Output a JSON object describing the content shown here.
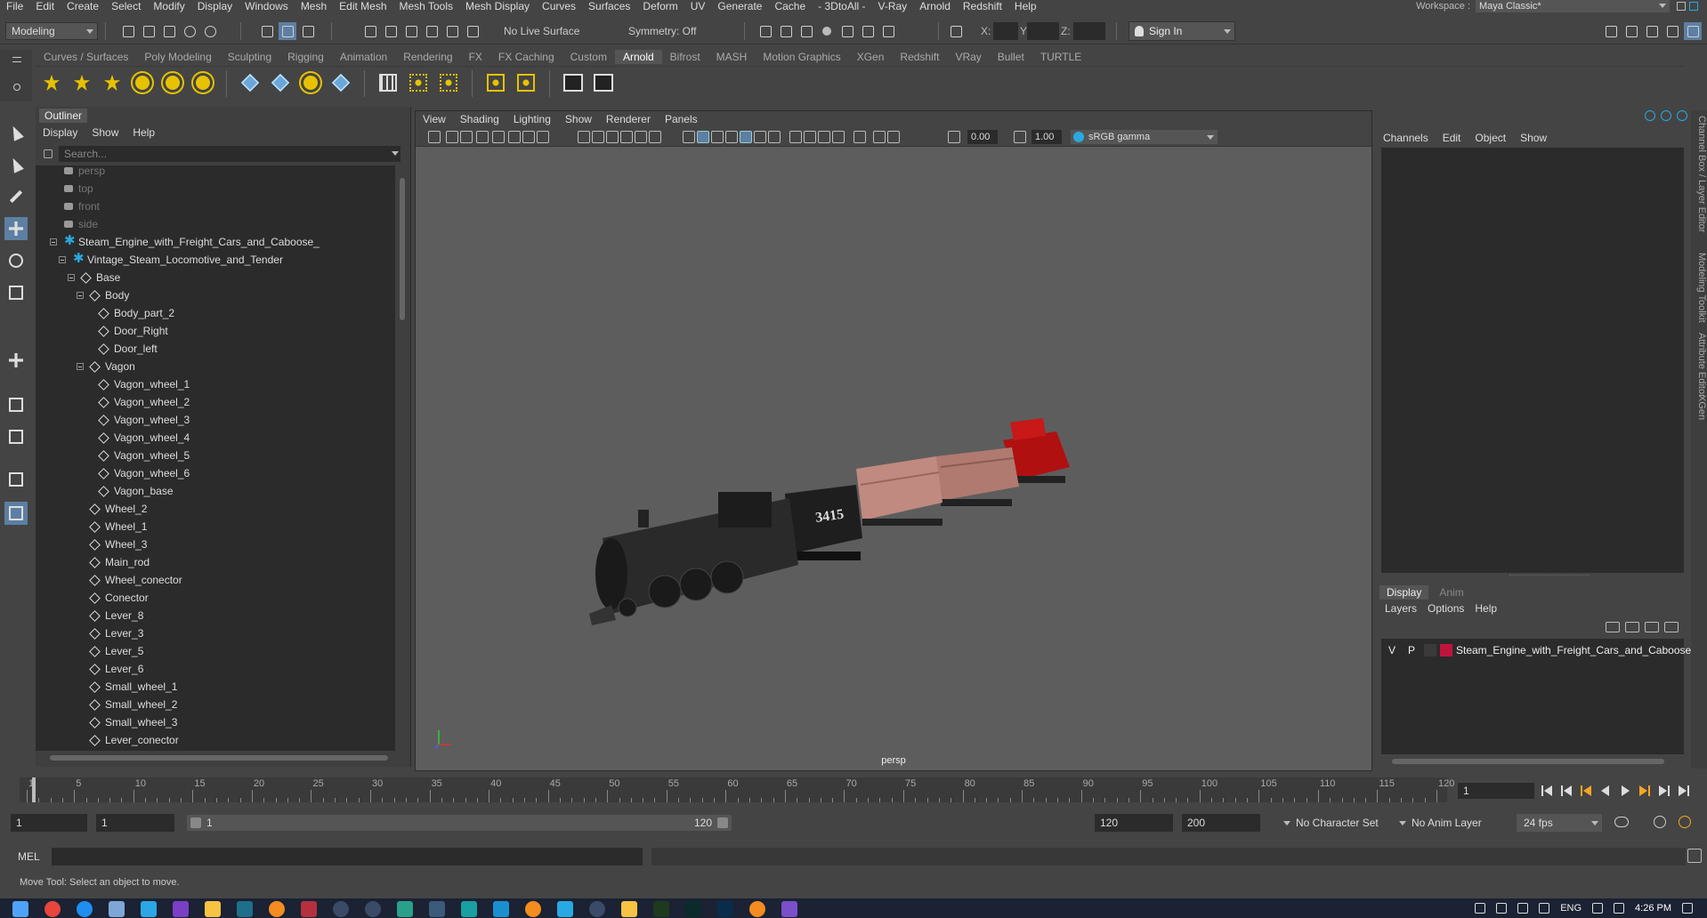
{
  "menubar": {
    "items": [
      "File",
      "Edit",
      "Create",
      "Select",
      "Modify",
      "Display",
      "Windows",
      "Mesh",
      "Edit Mesh",
      "Mesh Tools",
      "Mesh Display",
      "Curves",
      "Surfaces",
      "Deform",
      "UV",
      "Generate",
      "Cache",
      "- 3DtoAll -",
      "V-Ray",
      "Arnold",
      "Redshift",
      "Help"
    ],
    "workspace_label": "Workspace :",
    "workspace_value": "Maya Classic*"
  },
  "statusline": {
    "mode": "Modeling",
    "live_surface": "No Live Surface",
    "symmetry": "Symmetry: Off",
    "x_label": "X:",
    "y_label": "Y:",
    "z_label": "Z:",
    "sign_in": "Sign In"
  },
  "shelf": {
    "tabs": [
      "Curves / Surfaces",
      "Poly Modeling",
      "Sculpting",
      "Rigging",
      "Animation",
      "Rendering",
      "FX",
      "FX Caching",
      "Custom",
      "Arnold",
      "Bifrost",
      "MASH",
      "Motion Graphics",
      "XGen",
      "Redshift",
      "VRay",
      "Bullet",
      "TURTLE"
    ],
    "active_tab": "Arnold"
  },
  "outliner": {
    "title": "Outliner",
    "menu": [
      "Display",
      "Show",
      "Help"
    ],
    "search_placeholder": "Search...",
    "items": [
      {
        "label": "persp",
        "type": "camera",
        "dim": true
      },
      {
        "label": "top",
        "type": "camera",
        "dim": true
      },
      {
        "label": "front",
        "type": "camera",
        "dim": true
      },
      {
        "label": "side",
        "type": "camera",
        "dim": true
      },
      {
        "label": "Steam_Engine_with_Freight_Cars_and_Caboose_",
        "type": "asset"
      },
      {
        "label": "Vintage_Steam_Locomotive_and_Tender",
        "type": "asset"
      },
      {
        "label": "Base",
        "type": "mesh"
      },
      {
        "label": "Body",
        "type": "mesh"
      },
      {
        "label": "Body_part_2",
        "type": "mesh"
      },
      {
        "label": "Door_Right",
        "type": "mesh"
      },
      {
        "label": "Door_left",
        "type": "mesh"
      },
      {
        "label": "Vagon",
        "type": "mesh"
      },
      {
        "label": "Vagon_wheel_1",
        "type": "mesh"
      },
      {
        "label": "Vagon_wheel_2",
        "type": "mesh"
      },
      {
        "label": "Vagon_wheel_3",
        "type": "mesh"
      },
      {
        "label": "Vagon_wheel_4",
        "type": "mesh"
      },
      {
        "label": "Vagon_wheel_5",
        "type": "mesh"
      },
      {
        "label": "Vagon_wheel_6",
        "type": "mesh"
      },
      {
        "label": "Vagon_base",
        "type": "mesh"
      },
      {
        "label": "Wheel_2",
        "type": "mesh"
      },
      {
        "label": "Wheel_1",
        "type": "mesh"
      },
      {
        "label": "Wheel_3",
        "type": "mesh"
      },
      {
        "label": "Main_rod",
        "type": "mesh"
      },
      {
        "label": "Wheel_conector",
        "type": "mesh"
      },
      {
        "label": "Conector",
        "type": "mesh"
      },
      {
        "label": "Lever_8",
        "type": "mesh"
      },
      {
        "label": "Lever_3",
        "type": "mesh"
      },
      {
        "label": "Lever_5",
        "type": "mesh"
      },
      {
        "label": "Lever_6",
        "type": "mesh"
      },
      {
        "label": "Small_wheel_1",
        "type": "mesh"
      },
      {
        "label": "Small_wheel_2",
        "type": "mesh"
      },
      {
        "label": "Small_wheel_3",
        "type": "mesh"
      },
      {
        "label": "Lever_conector",
        "type": "mesh"
      }
    ]
  },
  "viewport": {
    "menu": [
      "View",
      "Shading",
      "Lighting",
      "Show",
      "Renderer",
      "Panels"
    ],
    "exposure": "0.00",
    "gamma": "1.00",
    "color_space": "sRGB gamma",
    "camera_label": "persp",
    "engine_number": "3415"
  },
  "channelbox": {
    "menu": [
      "Channels",
      "Edit",
      "Object",
      "Show"
    ],
    "side_tabs": [
      "Channel Box / Layer Editor",
      "Modeling Toolkit",
      "Attribute Editor",
      "XGen"
    ]
  },
  "layer_editor": {
    "tabs": [
      "Display",
      "Anim"
    ],
    "menu": [
      "Layers",
      "Options",
      "Help"
    ],
    "layer": {
      "v": "V",
      "p": "P",
      "name": "Steam_Engine_with_Freight_Cars_and_Caboose",
      "color": "#c0143c"
    }
  },
  "timeslider": {
    "ticks": [
      "1",
      "5",
      "10",
      "15",
      "20",
      "25",
      "30",
      "35",
      "40",
      "45",
      "50",
      "55",
      "60",
      "65",
      "70",
      "75",
      "80",
      "85",
      "90",
      "95",
      "100",
      "105",
      "110",
      "115",
      "120"
    ],
    "current_frame": "1"
  },
  "range": {
    "start": "1",
    "playback_start": "1",
    "range_start": "1",
    "range_end": "120",
    "playback_end": "120",
    "end": "200",
    "character_set": "No Character Set",
    "anim_layer": "No Anim Layer",
    "fps": "24 fps"
  },
  "cmdline": {
    "mel_label": "MEL"
  },
  "helpline": {
    "text": "Move Tool: Select an object to move."
  },
  "taskbar": {
    "lang": "ENG",
    "time": "4:26 PM"
  }
}
